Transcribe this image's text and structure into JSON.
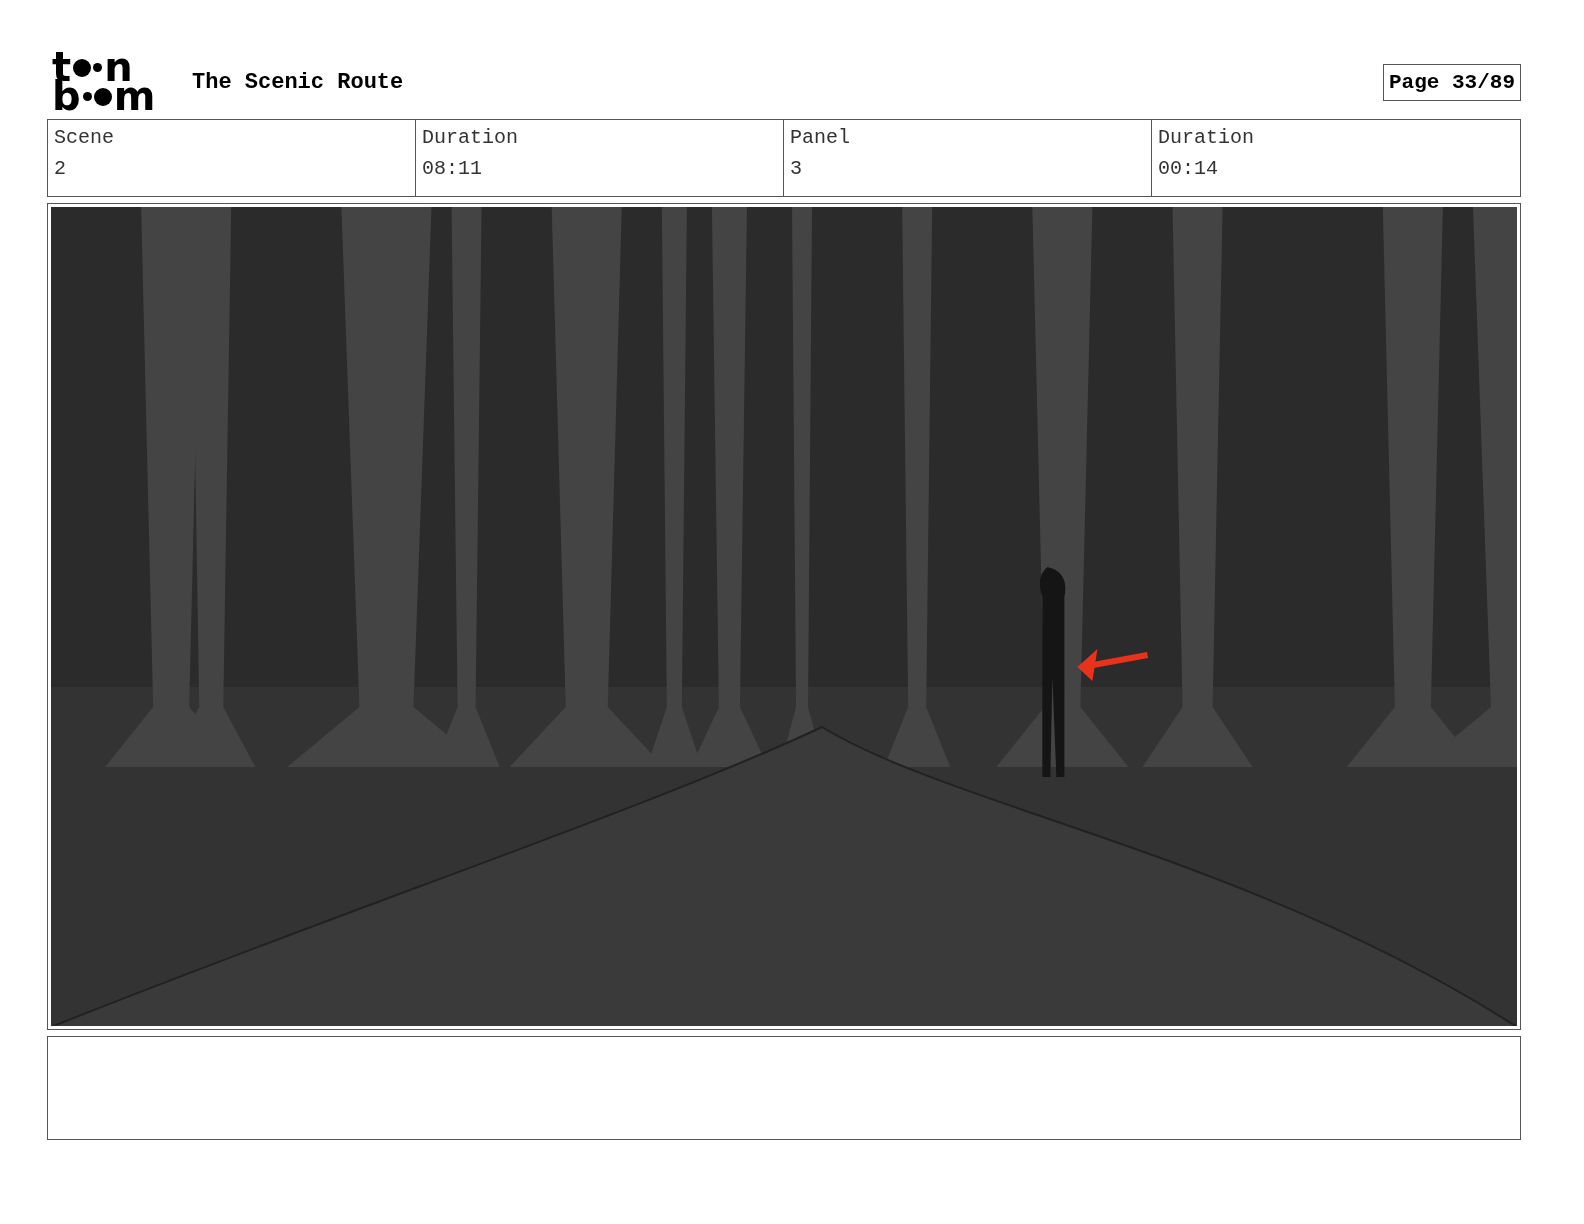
{
  "logo": {
    "top": [
      "t",
      "n"
    ],
    "bottom": [
      "b",
      "m"
    ]
  },
  "title": "The Scenic Route",
  "page": "Page 33/89",
  "info": [
    {
      "label": "Scene",
      "value": "2"
    },
    {
      "label": "Duration",
      "value": "08:11"
    },
    {
      "label": "Panel",
      "value": "3"
    },
    {
      "label": "Duration",
      "value": "00:14"
    }
  ]
}
